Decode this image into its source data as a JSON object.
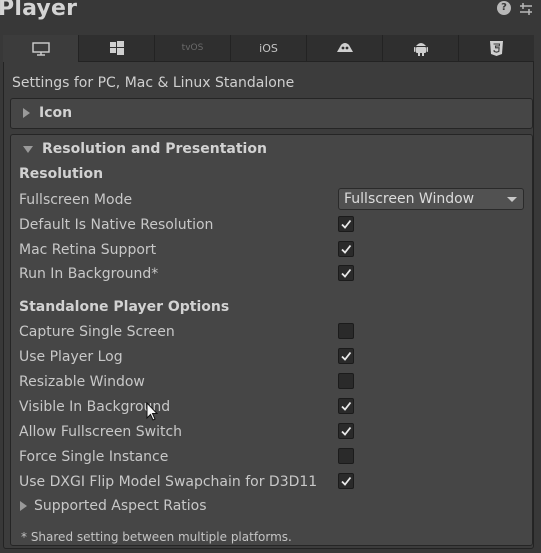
{
  "window": {
    "title": "Player"
  },
  "header_icons": [
    "help-icon",
    "preset-sliders-icon"
  ],
  "tabs": [
    {
      "label": "",
      "icon": "desktop-monitor-icon",
      "active": true
    },
    {
      "label": "",
      "icon": "windows-store-icon",
      "active": false
    },
    {
      "label": "tvOS",
      "icon": "",
      "active": false
    },
    {
      "label": "iOS",
      "icon": "",
      "active": false
    },
    {
      "label": "",
      "icon": "embedded-creature-icon",
      "active": false
    },
    {
      "label": "",
      "icon": "android-icon",
      "active": false
    },
    {
      "label": "",
      "icon": "html5-icon",
      "active": false
    }
  ],
  "settings_for": "Settings for PC, Mac & Linux Standalone",
  "sections": {
    "icon": {
      "title": "Icon",
      "expanded": false
    },
    "resolution": {
      "title": "Resolution and Presentation",
      "expanded": true
    }
  },
  "resolution": {
    "heading": "Resolution",
    "fullscreen_mode": {
      "label": "Fullscreen Mode",
      "value": "Fullscreen Window"
    },
    "rows": [
      {
        "label": "Default Is Native Resolution",
        "checked": true
      },
      {
        "label": "Mac Retina Support",
        "checked": true
      },
      {
        "label": "Run In Background*",
        "checked": true
      }
    ]
  },
  "standalone": {
    "heading": "Standalone Player Options",
    "rows": [
      {
        "label": "Capture Single Screen",
        "checked": false
      },
      {
        "label": "Use Player Log",
        "checked": true
      },
      {
        "label": "Resizable Window",
        "checked": false
      },
      {
        "label": "Visible In Background",
        "checked": true
      },
      {
        "label": "Allow Fullscreen Switch",
        "checked": true
      },
      {
        "label": "Force Single Instance",
        "checked": false
      },
      {
        "label": "Use DXGI Flip Model Swapchain for D3D11",
        "checked": true
      }
    ]
  },
  "supported_aspect_ratios": "Supported Aspect Ratios",
  "footnote": "* Shared setting between multiple platforms."
}
